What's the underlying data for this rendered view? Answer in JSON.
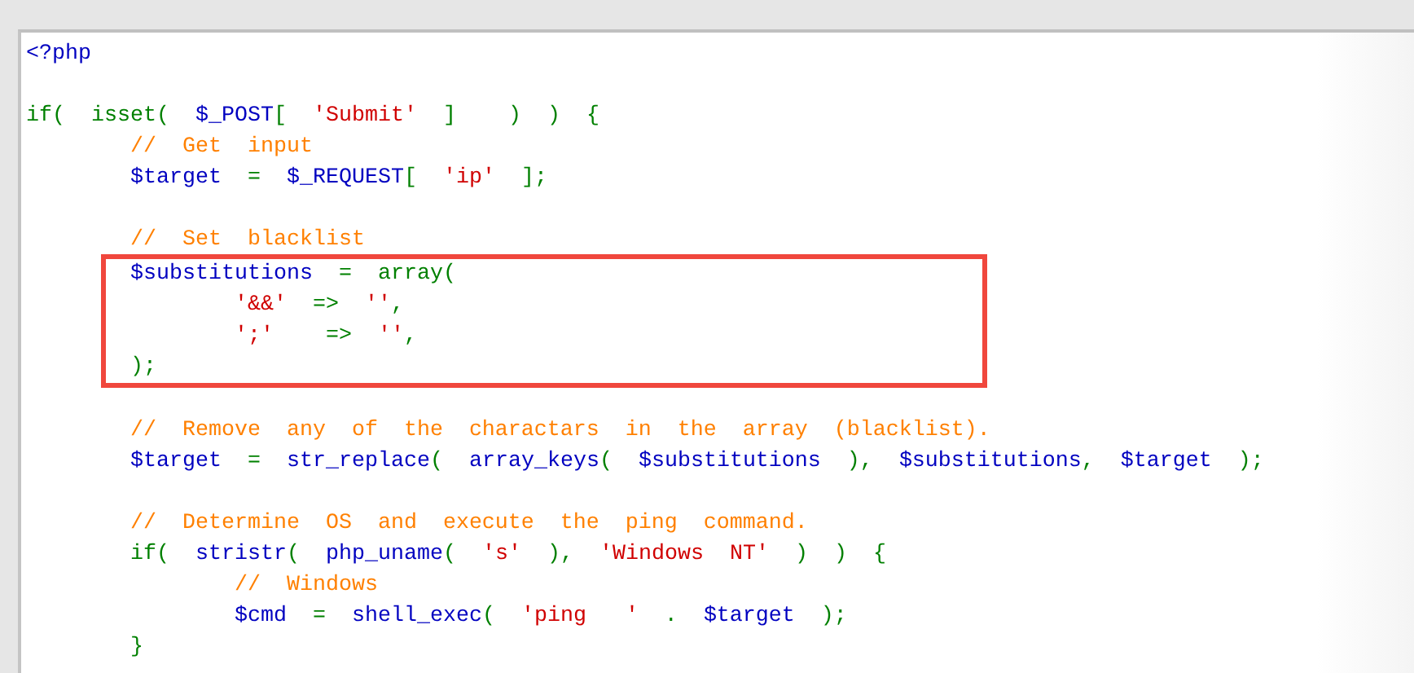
{
  "code_lines": [
    {
      "kind": "code",
      "highlighted": false,
      "tokens": [
        {
          "kind": "var",
          "text": "<?php"
        }
      ]
    },
    {
      "kind": "blank",
      "highlighted": false
    },
    {
      "kind": "code",
      "highlighted": false,
      "tokens": [
        {
          "kind": "kw",
          "text": "if(  isset(  "
        },
        {
          "kind": "var",
          "text": "$_POST"
        },
        {
          "kind": "kw",
          "text": "[  "
        },
        {
          "kind": "str",
          "text": "'Submit'"
        },
        {
          "kind": "kw",
          "text": "  ]    )  )  {"
        }
      ]
    },
    {
      "kind": "code",
      "highlighted": false,
      "tokens": [
        {
          "kind": "comment",
          "text": "        //  Get  input"
        }
      ]
    },
    {
      "kind": "code",
      "highlighted": false,
      "tokens": [
        {
          "kind": "var",
          "text": "        $target"
        },
        {
          "kind": "kw",
          "text": "  =  "
        },
        {
          "kind": "var",
          "text": "$_REQUEST"
        },
        {
          "kind": "kw",
          "text": "[  "
        },
        {
          "kind": "str",
          "text": "'ip'"
        },
        {
          "kind": "kw",
          "text": "  ];"
        }
      ]
    },
    {
      "kind": "blank",
      "highlighted": false
    },
    {
      "kind": "code",
      "highlighted": false,
      "tokens": [
        {
          "kind": "comment",
          "text": "        //  Set  blacklist"
        }
      ]
    },
    {
      "kind": "code",
      "highlighted": true,
      "tokens": [
        {
          "kind": "var",
          "text": "        $substitutions"
        },
        {
          "kind": "kw",
          "text": "  =  array("
        }
      ]
    },
    {
      "kind": "code",
      "highlighted": true,
      "tokens": [
        {
          "kind": "str",
          "text": "                '&&'"
        },
        {
          "kind": "kw",
          "text": "  =>  "
        },
        {
          "kind": "str",
          "text": "''"
        },
        {
          "kind": "kw",
          "text": ","
        }
      ]
    },
    {
      "kind": "code",
      "highlighted": true,
      "tokens": [
        {
          "kind": "str",
          "text": "                ';'"
        },
        {
          "kind": "kw",
          "text": "    =>  "
        },
        {
          "kind": "str",
          "text": "''"
        },
        {
          "kind": "kw",
          "text": ","
        }
      ]
    },
    {
      "kind": "code",
      "highlighted": true,
      "tokens": [
        {
          "kind": "kw",
          "text": "        );"
        }
      ]
    },
    {
      "kind": "blank",
      "highlighted": false
    },
    {
      "kind": "code",
      "highlighted": false,
      "tokens": [
        {
          "kind": "comment",
          "text": "        //  Remove  any  of  the  charactars  in  the  array  (blacklist)."
        }
      ]
    },
    {
      "kind": "code",
      "highlighted": false,
      "tokens": [
        {
          "kind": "var",
          "text": "        $target"
        },
        {
          "kind": "kw",
          "text": "  =  "
        },
        {
          "kind": "var",
          "text": "str_replace"
        },
        {
          "kind": "kw",
          "text": "(  "
        },
        {
          "kind": "var",
          "text": "array_keys"
        },
        {
          "kind": "kw",
          "text": "(  "
        },
        {
          "kind": "var",
          "text": "$substitutions"
        },
        {
          "kind": "kw",
          "text": "  ),  "
        },
        {
          "kind": "var",
          "text": "$substitutions"
        },
        {
          "kind": "kw",
          "text": ",  "
        },
        {
          "kind": "var",
          "text": "$target"
        },
        {
          "kind": "kw",
          "text": "  );"
        }
      ]
    },
    {
      "kind": "blank",
      "highlighted": false
    },
    {
      "kind": "code",
      "highlighted": false,
      "tokens": [
        {
          "kind": "comment",
          "text": "        //  Determine  OS  and  execute  the  ping  command."
        }
      ]
    },
    {
      "kind": "code",
      "highlighted": false,
      "tokens": [
        {
          "kind": "kw",
          "text": "        if(  "
        },
        {
          "kind": "var",
          "text": "stristr"
        },
        {
          "kind": "kw",
          "text": "(  "
        },
        {
          "kind": "var",
          "text": "php_uname"
        },
        {
          "kind": "kw",
          "text": "(  "
        },
        {
          "kind": "str",
          "text": "'s'"
        },
        {
          "kind": "kw",
          "text": "  ),  "
        },
        {
          "kind": "str",
          "text": "'Windows  NT'"
        },
        {
          "kind": "kw",
          "text": "  )  )  {"
        }
      ]
    },
    {
      "kind": "code",
      "highlighted": false,
      "tokens": [
        {
          "kind": "comment",
          "text": "                //  Windows"
        }
      ]
    },
    {
      "kind": "code",
      "highlighted": false,
      "tokens": [
        {
          "kind": "var",
          "text": "                $cmd"
        },
        {
          "kind": "kw",
          "text": "  =  "
        },
        {
          "kind": "var",
          "text": "shell_exec"
        },
        {
          "kind": "kw",
          "text": "(  "
        },
        {
          "kind": "str",
          "text": "'ping   '"
        },
        {
          "kind": "kw",
          "text": "  .  "
        },
        {
          "kind": "var",
          "text": "$target"
        },
        {
          "kind": "kw",
          "text": "  );"
        }
      ]
    },
    {
      "kind": "code",
      "highlighted": false,
      "tokens": [
        {
          "kind": "kw",
          "text": "        }"
        }
      ]
    }
  ]
}
